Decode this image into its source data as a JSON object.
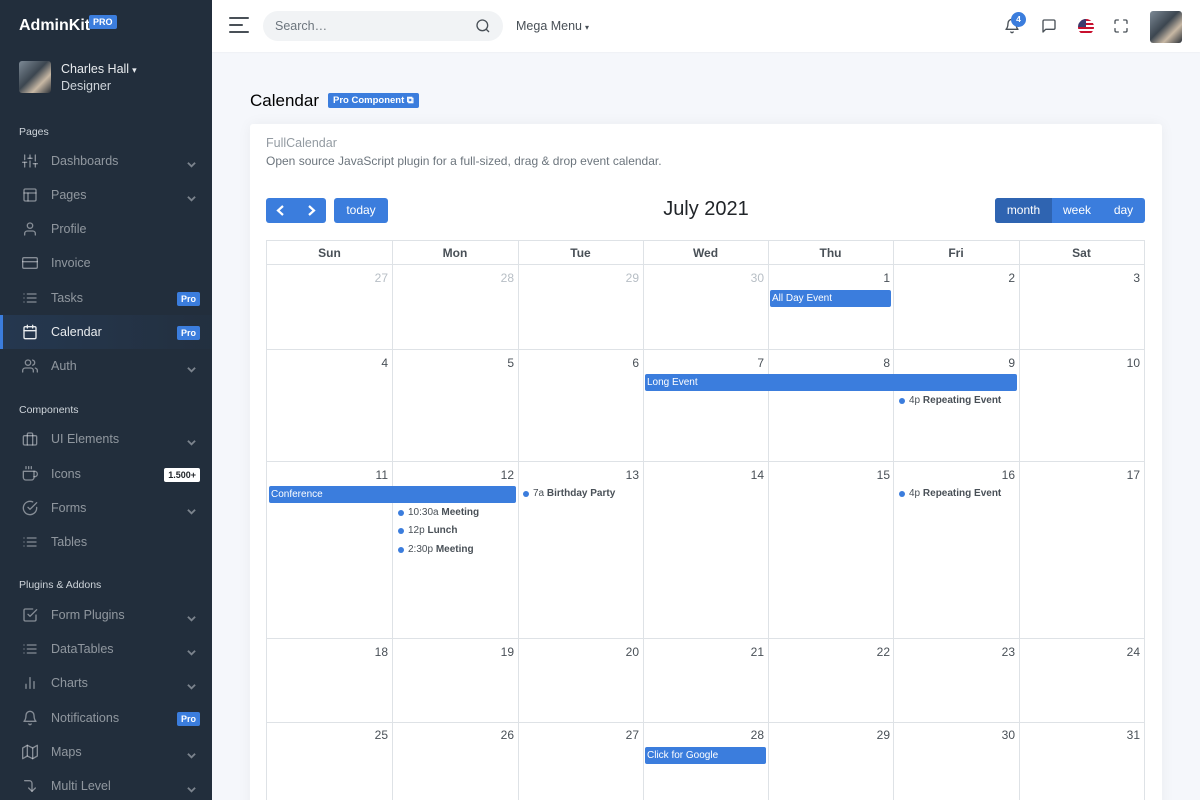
{
  "sidebar": {
    "brand": "AdminKit",
    "brand_badge": "PRO",
    "user": {
      "name": "Charles Hall",
      "role": "Designer"
    },
    "sections": [
      {
        "header": "Pages"
      },
      {
        "header": "Components"
      },
      {
        "header": "Plugins & Addons"
      }
    ],
    "items": [
      {
        "label": "Dashboards",
        "icon": "sliders-icon"
      },
      {
        "label": "Pages",
        "icon": "layout-icon"
      },
      {
        "label": "Profile",
        "icon": "user-icon"
      },
      {
        "label": "Invoice",
        "icon": "credit-card-icon"
      },
      {
        "label": "Tasks",
        "icon": "list-icon",
        "badge": "Pro"
      },
      {
        "label": "Calendar",
        "icon": "calendar-icon",
        "badge": "Pro",
        "active": true
      },
      {
        "label": "Auth",
        "icon": "users-icon"
      },
      {
        "label": "UI Elements",
        "icon": "briefcase-icon"
      },
      {
        "label": "Icons",
        "icon": "coffee-icon",
        "badge": "1.500+"
      },
      {
        "label": "Forms",
        "icon": "check-circle-icon"
      },
      {
        "label": "Tables",
        "icon": "list-icon"
      },
      {
        "label": "Form Plugins",
        "icon": "check-square-icon"
      },
      {
        "label": "DataTables",
        "icon": "list-icon"
      },
      {
        "label": "Charts",
        "icon": "bar-chart-icon"
      },
      {
        "label": "Notifications",
        "icon": "bell-icon",
        "badge": "Pro"
      },
      {
        "label": "Maps",
        "icon": "map-icon"
      },
      {
        "label": "Multi Level",
        "icon": "corner-right-down-icon"
      }
    ]
  },
  "topbar": {
    "search_placeholder": "Search…",
    "mega_menu": "Mega Menu",
    "notification_count": "4"
  },
  "page": {
    "title": "Calendar",
    "title_badge": "Pro Component"
  },
  "card": {
    "title": "FullCalendar",
    "subtitle": "Open source JavaScript plugin for a full-sized, drag & drop event calendar."
  },
  "calendar": {
    "title": "July 2021",
    "today_label": "today",
    "views": [
      "month",
      "week",
      "day"
    ],
    "active_view": "month",
    "days_of_week": [
      "Sun",
      "Mon",
      "Tue",
      "Wed",
      "Thu",
      "Fri",
      "Sat"
    ],
    "weeks": [
      [
        "27",
        "28",
        "29",
        "30",
        "1",
        "2",
        "3"
      ],
      [
        "4",
        "5",
        "6",
        "7",
        "8",
        "9",
        "10"
      ],
      [
        "11",
        "12",
        "13",
        "14",
        "15",
        "16",
        "17"
      ],
      [
        "18",
        "19",
        "20",
        "21",
        "22",
        "23",
        "24"
      ],
      [
        "25",
        "26",
        "27",
        "28",
        "29",
        "30",
        "31"
      ]
    ],
    "events": {
      "all_day": "All Day Event",
      "long_event": "Long Event",
      "repeating_1": {
        "time": "4p",
        "name": "Repeating Event"
      },
      "conference": "Conference",
      "birthday": {
        "time": "7a",
        "name": "Birthday Party"
      },
      "meeting_1": {
        "time": "10:30a",
        "name": "Meeting"
      },
      "lunch": {
        "time": "12p",
        "name": "Lunch"
      },
      "meeting_2": {
        "time": "2:30p",
        "name": "Meeting"
      },
      "repeating_2": {
        "time": "4p",
        "name": "Repeating Event"
      },
      "google": "Click for Google"
    }
  }
}
